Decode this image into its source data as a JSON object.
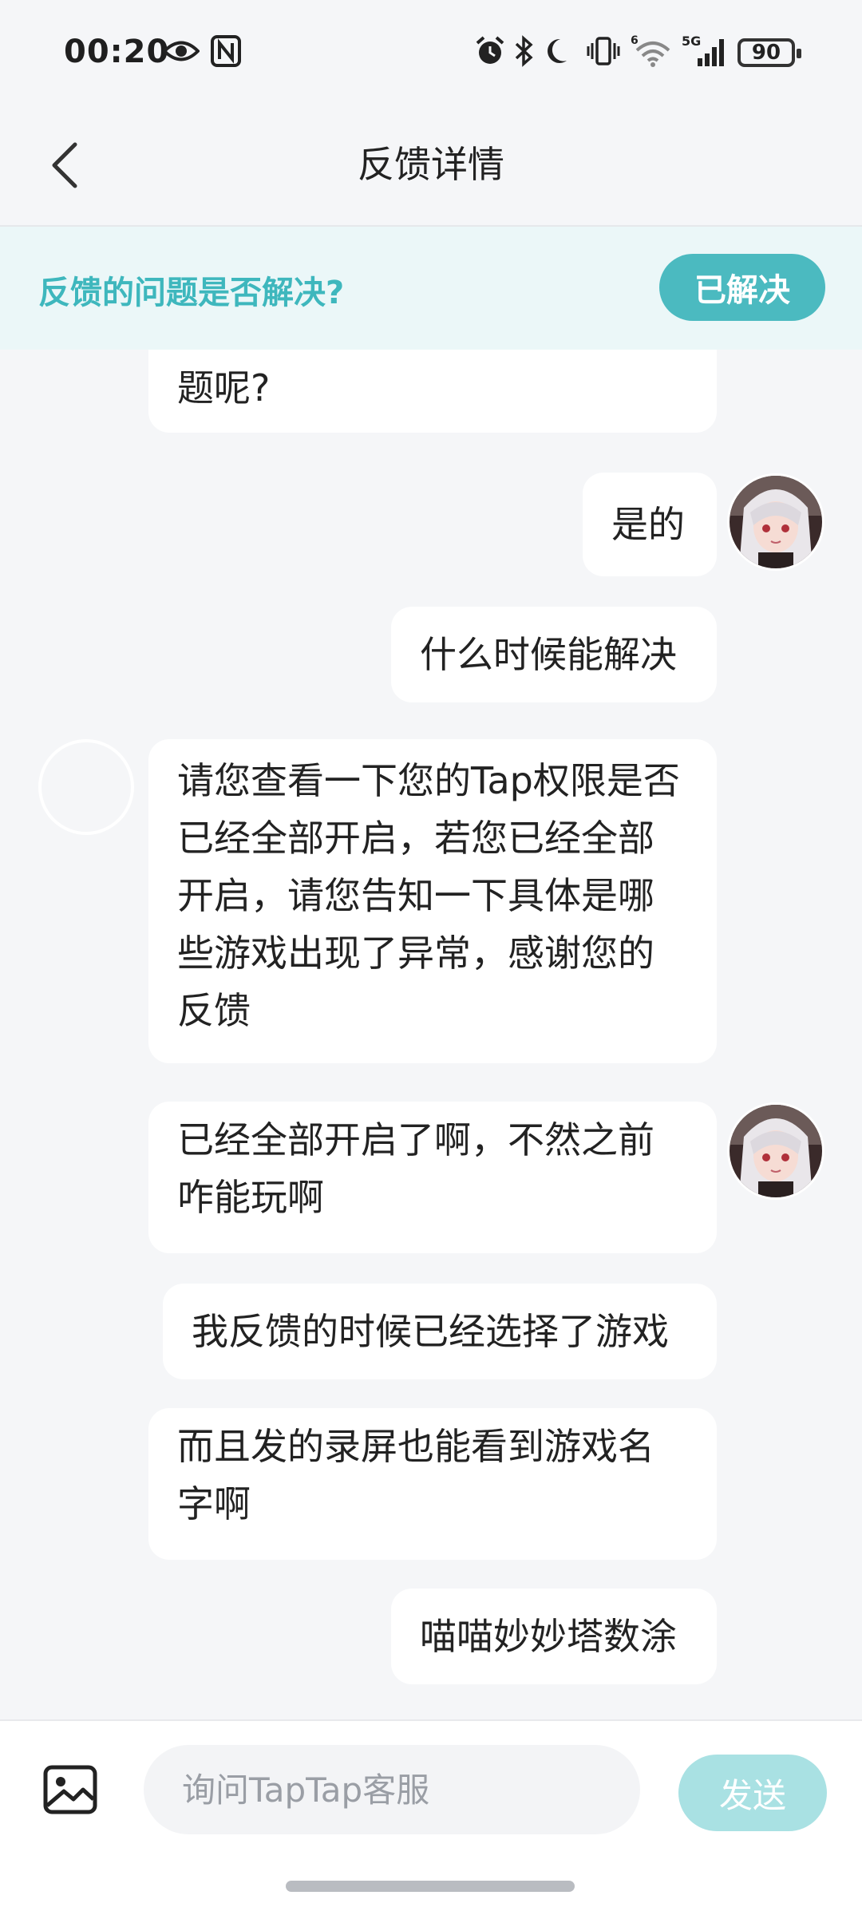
{
  "status_bar": {
    "time": "00:20",
    "network": "5G",
    "battery": "90",
    "icons": [
      "eye-icon",
      "nfc-icon",
      "alarm-icon",
      "bluetooth-icon",
      "moon-icon",
      "vibrate-icon",
      "wifi-icon",
      "signal-icon",
      "battery-icon"
    ]
  },
  "header": {
    "title": "反馈详情",
    "back_icon": "chevron-left-icon"
  },
  "banner": {
    "question": "反馈的问题是否解决?",
    "resolved_label": "已解决",
    "accent_color": "#3eb7bd"
  },
  "messages": [
    {
      "from": "agent",
      "text": "题呢?"
    },
    {
      "from": "user",
      "text": "是的"
    },
    {
      "from": "user",
      "text": "什么时候能解决"
    },
    {
      "from": "agent",
      "text": "请您查看一下您的Tap权限是否已经全部开启，若您已经全部开启，请您告知一下具体是哪些游戏出现了异常，感谢您的反馈"
    },
    {
      "from": "user",
      "text": "已经全部开启了啊，不然之前咋能玩啊"
    },
    {
      "from": "user",
      "text": "我反馈的时候已经选择了游戏"
    },
    {
      "from": "user",
      "text": "而且发的录屏也能看到游戏名字啊"
    },
    {
      "from": "user",
      "text": "喵喵妙妙塔数涂"
    }
  ],
  "input": {
    "placeholder": "询问TapTap客服",
    "value": "",
    "send_label": "发送",
    "image_icon": "image-icon"
  },
  "colors": {
    "background": "#f5f6f8",
    "accent": "#4bbac0",
    "send_disabled": "#a9e1e3"
  }
}
